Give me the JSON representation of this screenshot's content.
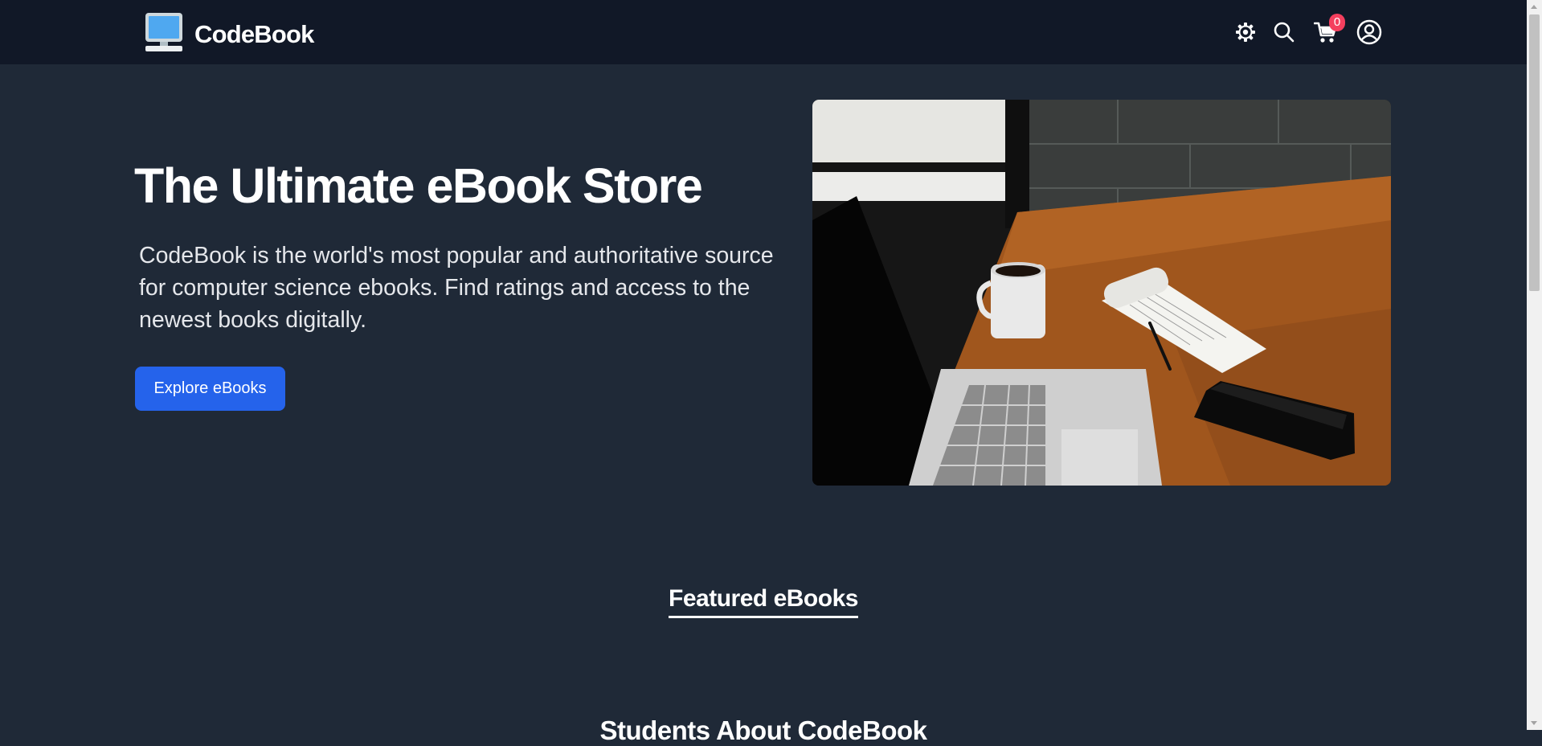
{
  "brand": {
    "name": "CodeBook",
    "logo_icon": "monitor-icon"
  },
  "nav": {
    "icons": [
      "gear-icon",
      "search-icon",
      "cart-icon",
      "user-icon"
    ],
    "cart_count": "0"
  },
  "hero": {
    "title": "The Ultimate eBook Store",
    "description": "CodeBook is the world's most popular and authoritative source for computer science ebooks. Find ratings and access to the newest books digitally.",
    "cta_label": "Explore eBooks",
    "image_alt": "Laptop, coffee mug, notepad and phone on a wooden desk"
  },
  "sections": {
    "featured_title": "Featured eBooks",
    "testimonials_title": "Students About CodeBook"
  },
  "colors": {
    "navbar_bg": "#111827",
    "page_bg": "#1f2937",
    "accent": "#2563eb",
    "badge": "#f43f5e"
  }
}
